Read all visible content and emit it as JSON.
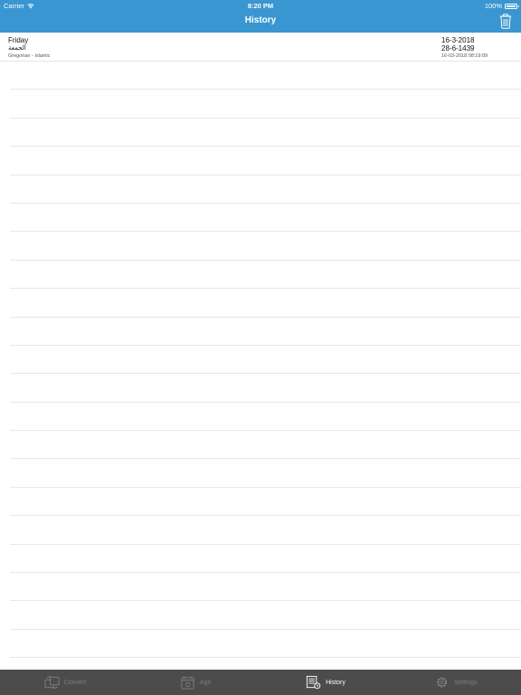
{
  "status_bar": {
    "carrier": "Carrier",
    "time": "8:20 PM",
    "battery": "100%"
  },
  "nav": {
    "title": "History",
    "trash_icon": "trash-icon"
  },
  "entries": [
    {
      "weekday": "Friday",
      "weekday_arabic": "الجمعة",
      "conversion": "Gregorian - Islamic",
      "gregorian_date": "16-3-2018",
      "hijri_date": "28-6-1439",
      "timestamp": "16-03-2018 08:19:09"
    }
  ],
  "tabs": [
    {
      "label": "Convert",
      "icon": "convert-icon",
      "active": false
    },
    {
      "label": "Age",
      "icon": "calendar-icon",
      "active": false
    },
    {
      "label": "History",
      "icon": "history-icon",
      "active": true
    },
    {
      "label": "Settings",
      "icon": "gear-icon",
      "active": false
    }
  ],
  "colors": {
    "header": "#3a96d0",
    "tabbar": "#4c4c4c",
    "tab_inactive": "#7e7e7e",
    "tab_active": "#ffffff"
  }
}
